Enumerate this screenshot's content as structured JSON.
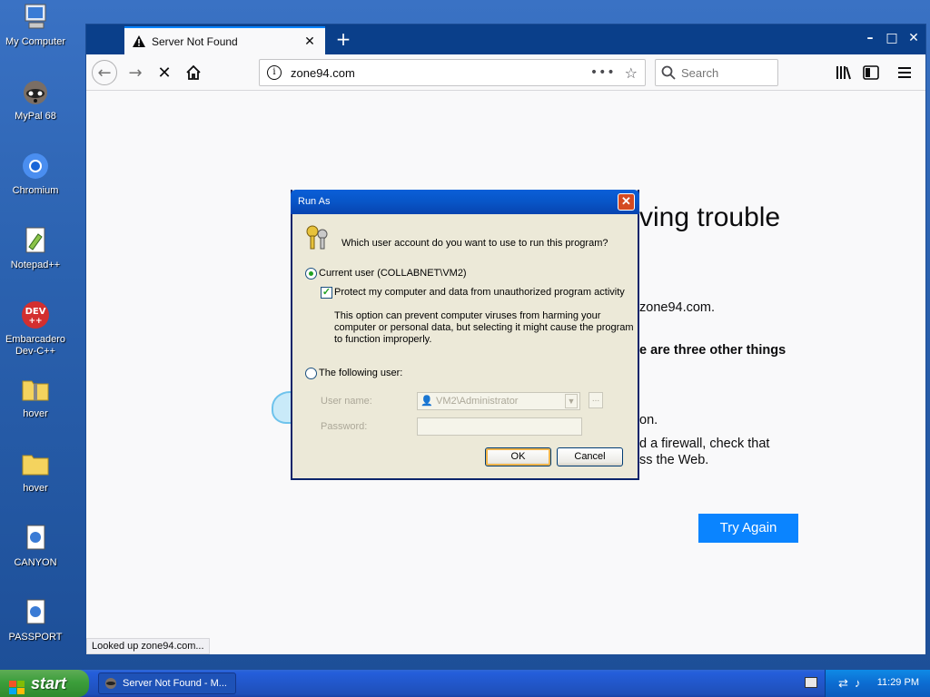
{
  "desktop": {
    "icons": [
      {
        "label": "My Computer",
        "icon": "computer-icon"
      },
      {
        "label": "MyPal 68",
        "icon": "raccoon-browser-icon"
      },
      {
        "label": "Chromium",
        "icon": "chromium-icon"
      },
      {
        "label": "Notepad++",
        "icon": "notepad-plus-icon"
      },
      {
        "label": "Embarcadero Dev-C++",
        "icon": "devcpp-icon"
      },
      {
        "label": "hover",
        "icon": "zip-folder-icon"
      },
      {
        "label": "hover",
        "icon": "folder-icon"
      },
      {
        "label": "CANYON",
        "icon": "audio-file-icon"
      },
      {
        "label": "PASSPORT",
        "icon": "audio-file-icon"
      }
    ]
  },
  "browser": {
    "tab_title": "Server Not Found",
    "url": "zone94.com",
    "search_placeholder": "Search",
    "status_text": "Looked up zone94.com...",
    "error": {
      "title": "ving trouble",
      "line1": "zone94.com.",
      "line2": "e are three other things",
      "line3": "on.",
      "line4": "d a firewall, check that",
      "line5": "ss the Web."
    },
    "try_again": "Try Again"
  },
  "dialog": {
    "title": "Run As",
    "question": "Which user account do you want to use to run this program?",
    "current_user_label": "Current user (COLLABNET\\VM2)",
    "protect_label": "Protect my computer and data from unauthorized program activity",
    "protect_desc": "This option can prevent computer viruses from harming your computer or personal data, but selecting it might cause the program to function improperly.",
    "following_user_label": "The following user:",
    "username_label": "User name:",
    "username_value": "VM2\\Administrator",
    "password_label": "Password:",
    "ellipsis": "...",
    "ok": "OK",
    "cancel": "Cancel"
  },
  "taskbar": {
    "start": "start",
    "task_label": "Server Not Found - M...",
    "clock": "11:29 PM"
  }
}
